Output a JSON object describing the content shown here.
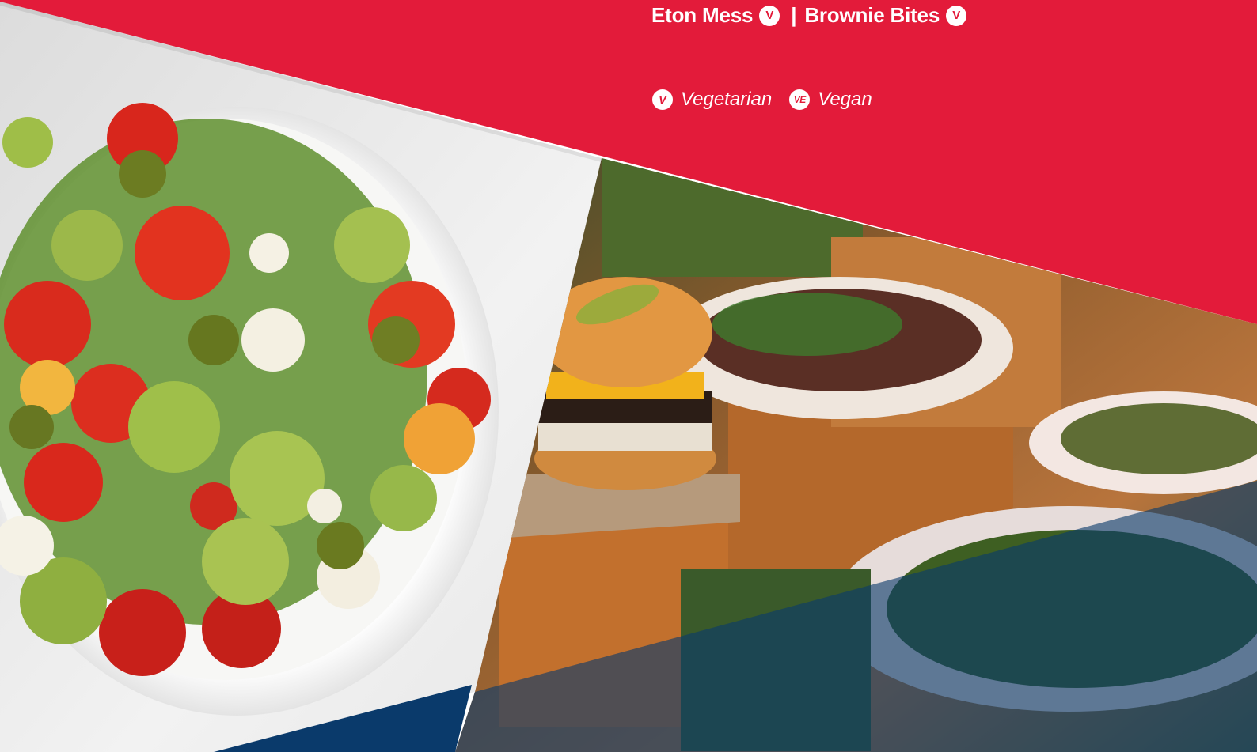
{
  "dishes": [
    {
      "name": "Eton Mess",
      "diet_code": "V"
    },
    {
      "name": "Brownie Bites",
      "diet_code": "V"
    }
  ],
  "separator": "|",
  "legend": [
    {
      "code": "V",
      "label": "Vegetarian"
    },
    {
      "code": "VE",
      "label": "Vegan"
    }
  ],
  "colors": {
    "brand_red": "#e31b3a",
    "brand_navy": "#0a3a6b",
    "badge_text": "#e31b3a",
    "text_on_red": "#ffffff"
  },
  "photos": [
    {
      "name": "salad-bowl-photo"
    },
    {
      "name": "burger-buffet-photo"
    }
  ]
}
